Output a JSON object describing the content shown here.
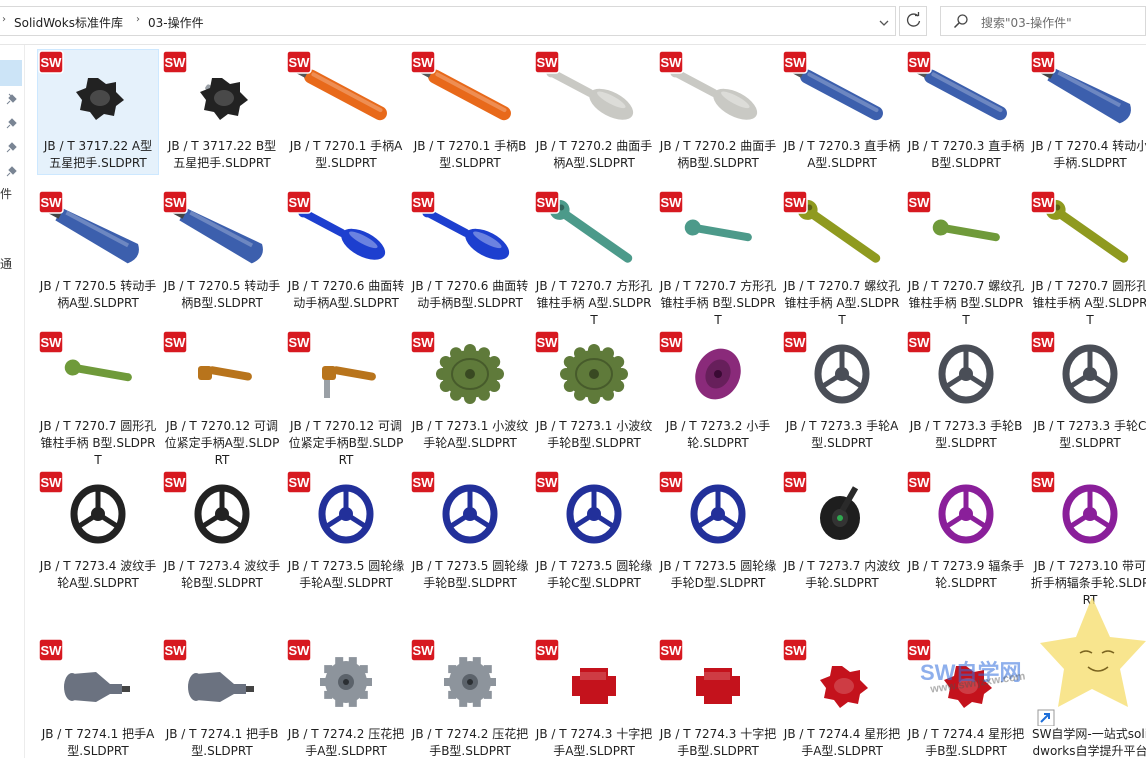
{
  "address": {
    "crumbs": [
      "SolidWoks标准件库",
      "03-操作件"
    ]
  },
  "search": {
    "placeholder": "搜索\"03-操作件\""
  },
  "nav": {
    "partial_label_1": "件",
    "partial_label_2": "通"
  },
  "files": [
    {
      "name": "JB / T 3717.22 A型五星把手.SLDPRT",
      "icon": "star-knob",
      "color": "#222222",
      "selected": true
    },
    {
      "name": "JB / T 3717.22 B型五星把手.SLDPRT",
      "icon": "star-knob-stud",
      "color": "#222222"
    },
    {
      "name": "JB / T 7270.1 手柄A型.SLDPRT",
      "icon": "rod-handle",
      "color": "#e8691a"
    },
    {
      "name": "JB / T 7270.1 手柄B型.SLDPRT",
      "icon": "rod-handle",
      "color": "#e8691a"
    },
    {
      "name": "JB / T 7270.2 曲面手柄A型.SLDPRT",
      "icon": "bulb-handle",
      "color": "#c9c9c4"
    },
    {
      "name": "JB / T 7270.2 曲面手柄B型.SLDPRT",
      "icon": "bulb-handle",
      "color": "#c9c9c4"
    },
    {
      "name": "JB / T 7270.3 直手柄A型.SLDPRT",
      "icon": "rod-handle",
      "color": "#3c5fad"
    },
    {
      "name": "JB / T 7270.3 直手柄B型.SLDPRT",
      "icon": "rod-handle",
      "color": "#3c5fad"
    },
    {
      "name": "JB / T 7270.4 转动小手柄.SLDPRT",
      "icon": "thick-handle",
      "color": "#3c5fad"
    },
    {
      "name": "JB / T 7270.5 转动手柄A型.SLDPRT",
      "icon": "thick-handle",
      "color": "#3c5fad"
    },
    {
      "name": "JB / T 7270.5 转动手柄B型.SLDPRT",
      "icon": "thick-handle",
      "color": "#3c5fad"
    },
    {
      "name": "JB / T 7270.6 曲面转动手柄A型.SLDPRT",
      "icon": "bulb-handle",
      "color": "#1d3fcf"
    },
    {
      "name": "JB / T 7270.6 曲面转动手柄B型.SLDPRT",
      "icon": "bulb-handle",
      "color": "#1d3fcf"
    },
    {
      "name": "JB / T 7270.7 方形孔锥柱手柄 A型.SLDPRT",
      "icon": "ball-lever",
      "color": "#4c9a8a"
    },
    {
      "name": "JB / T 7270.7 方形孔锥柱手柄 B型.SLDPRT",
      "icon": "short-lever",
      "color": "#4c9a8a"
    },
    {
      "name": "JB / T 7270.7 螺纹孔锥柱手柄 A型.SLDPRT",
      "icon": "ball-lever",
      "color": "#8f9a1f"
    },
    {
      "name": "JB / T 7270.7 螺纹孔锥柱手柄 B型.SLDPRT",
      "icon": "short-lever",
      "color": "#6f9a3a"
    },
    {
      "name": "JB / T 7270.7 圆形孔锥柱手柄 A型.SLDPRT",
      "icon": "ball-lever",
      "color": "#8f9a1f"
    },
    {
      "name": "JB / T 7270.7 圆形孔锥柱手柄 B型.SLDPRT",
      "icon": "short-lever",
      "color": "#6f9a3a"
    },
    {
      "name": "JB / T 7270.12 可调位紧定手柄A型.SLDPRT",
      "icon": "clamp-lever",
      "color": "#b8741c"
    },
    {
      "name": "JB / T 7270.12 可调位紧定手柄B型.SLDPRT",
      "icon": "clamp-lever-stud",
      "color": "#b8741c"
    },
    {
      "name": "JB / T 7273.1 小波纹手轮A型.SLDPRT",
      "icon": "wavy-wheel",
      "color": "#5f7a3a"
    },
    {
      "name": "JB / T 7273.1 小波纹手轮B型.SLDPRT",
      "icon": "wavy-wheel",
      "color": "#5f7a3a"
    },
    {
      "name": "JB / T 7273.2 小手轮.SLDPRT",
      "icon": "disc-wheel",
      "color": "#8a2a7a"
    },
    {
      "name": "JB / T 7273.3 手轮A型.SLDPRT",
      "icon": "spoke-wheel",
      "color": "#4a4e57"
    },
    {
      "name": "JB / T 7273.3 手轮B型.SLDPRT",
      "icon": "spoke-wheel",
      "color": "#4a4e57"
    },
    {
      "name": "JB / T 7273.3 手轮C型.SLDPRT",
      "icon": "spoke-wheel",
      "color": "#4a4e57"
    },
    {
      "name": "JB / T 7273.4 波纹手轮A型.SLDPRT",
      "icon": "spoke-wheel",
      "color": "#222222"
    },
    {
      "name": "JB / T 7273.4 波纹手轮B型.SLDPRT",
      "icon": "spoke-wheel",
      "color": "#222222"
    },
    {
      "name": "JB / T 7273.5 圆轮缘手轮A型.SLDPRT",
      "icon": "spoke-wheel",
      "color": "#22309a"
    },
    {
      "name": "JB / T 7273.5 圆轮缘手轮B型.SLDPRT",
      "icon": "spoke-wheel",
      "color": "#22309a"
    },
    {
      "name": "JB / T 7273.5 圆轮缘手轮C型.SLDPRT",
      "icon": "spoke-wheel",
      "color": "#22309a"
    },
    {
      "name": "JB / T 7273.5 圆轮缘手轮D型.SLDPRT",
      "icon": "spoke-wheel",
      "color": "#22309a"
    },
    {
      "name": "JB / T 7273.7 内波纹手轮.SLDPRT",
      "icon": "crank-disc",
      "color": "#1e1e1e"
    },
    {
      "name": "JB / T 7273.9 辐条手轮.SLDPRT",
      "icon": "spoke-wheel",
      "color": "#8a1f9a"
    },
    {
      "name": "JB / T 7273.10 带可折手柄辐条手轮.SLDPRT",
      "icon": "spoke-wheel",
      "color": "#8a1f9a"
    },
    {
      "name": "JB / T 7274.1 把手A型.SLDPRT",
      "icon": "cone-knob",
      "color": "#6b7280"
    },
    {
      "name": "JB / T 7274.1 把手B型.SLDPRT",
      "icon": "cone-knob",
      "color": "#6b7280"
    },
    {
      "name": "JB / T 7274.2 压花把手A型.SLDPRT",
      "icon": "gear-knob",
      "color": "#8d949c"
    },
    {
      "name": "JB / T 7274.2 压花把手B型.SLDPRT",
      "icon": "gear-knob",
      "color": "#8d949c"
    },
    {
      "name": "JB / T 7274.3 十字把手A型.SLDPRT",
      "icon": "cross-knob",
      "color": "#c4121c"
    },
    {
      "name": "JB / T 7274.3 十字把手B型.SLDPRT",
      "icon": "cross-knob",
      "color": "#c4121c"
    },
    {
      "name": "JB / T 7274.4 星形把手A型.SLDPRT",
      "icon": "star-knob-red",
      "color": "#c4121c"
    },
    {
      "name": "JB / T 7274.4 星形把手B型.SLDPRT",
      "icon": "star-knob-red",
      "color": "#c4121c"
    },
    {
      "name": "SW自学网-一站式solidworks自学提升平台",
      "icon": "shortcut-star",
      "color": "#f7d84a"
    }
  ],
  "watermark": {
    "line1": "SW自学网",
    "line2": "www.swrjzxw.com"
  },
  "colors": {
    "selection": "#cce4f7",
    "sw_badge": "#d71920"
  }
}
